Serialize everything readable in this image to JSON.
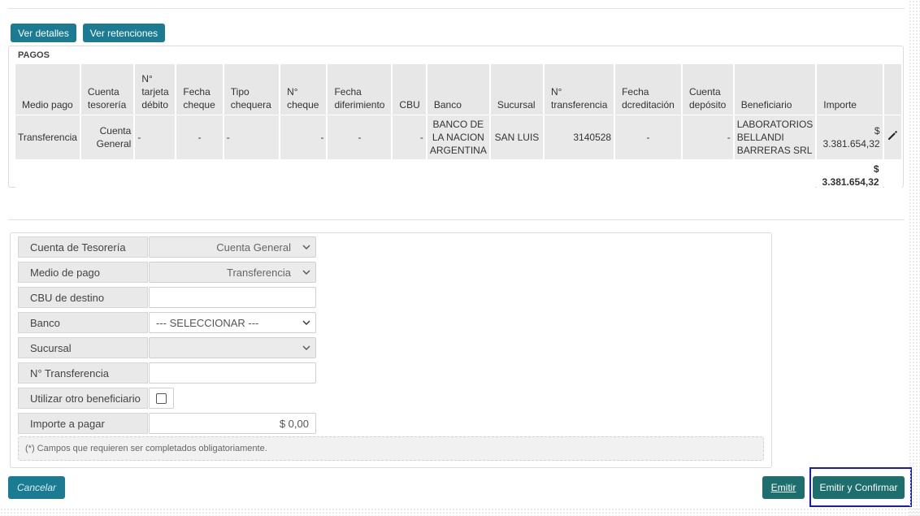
{
  "top_buttons": {
    "ver_detalles": "Ver detalles",
    "ver_retenciones": "Ver retenciones"
  },
  "pagos": {
    "title": "PAGOS",
    "headers": [
      "Medio pago",
      "Cuenta tesorería",
      "N° tarjeta débito",
      "Fecha cheque",
      "Tipo chequera",
      "N° cheque",
      "Fecha diferimiento",
      "CBU",
      "Banco",
      "Sucursal",
      "N° transferencia",
      "Fecha dcreditación",
      "Cuenta depósito",
      "Beneficiario",
      "Importe"
    ],
    "row": {
      "medio_pago": "Transferencia",
      "cuenta_tesoreria": "Cuenta General",
      "tarjeta_debito": "-",
      "fecha_cheque": "-",
      "tipo_chequera": "-",
      "nro_cheque": "-",
      "fecha_diferimiento": "-",
      "cbu": "-",
      "banco": "BANCO DE LA NACION ARGENTINA",
      "sucursal": "SAN LUIS",
      "nro_transferencia": "3140528",
      "fecha_acreditacion": "-",
      "cuenta_deposito": "-",
      "beneficiario": "LABORATORIOS BELLANDI BARRERAS SRL",
      "importe": "$ 3.381.654,32",
      "edit_icon": "pencil-icon"
    },
    "total": "$ 3.381.654,32"
  },
  "form": {
    "cuenta_tesoreria": {
      "label": "Cuenta de Tesorería",
      "value": "Cuenta General"
    },
    "medio_pago": {
      "label": "Medio de pago",
      "value": "Transferencia"
    },
    "cbu_destino": {
      "label": "CBU de destino",
      "value": ""
    },
    "banco": {
      "label": "Banco",
      "value": "--- SELECCIONAR ---"
    },
    "sucursal": {
      "label": "Sucursal",
      "value": ""
    },
    "nro_transferencia": {
      "label": "N° Transferencia",
      "value": ""
    },
    "otro_beneficiario": {
      "label": "Utilizar otro beneficiario",
      "checked": false
    },
    "importe_pagar": {
      "label": "Importe a pagar",
      "value": "$ 0,00"
    },
    "note": "(*) Campos que requieren ser completados obligatoriamente."
  },
  "actions": {
    "cancelar": "Cancelar",
    "emitir": "Emitir",
    "emitir_confirmar": "Emitir y Confirmar"
  },
  "colors": {
    "button": "#1b7b93",
    "button_dark": "#1d6f6d",
    "focus_outline": "#1a1ab8"
  }
}
